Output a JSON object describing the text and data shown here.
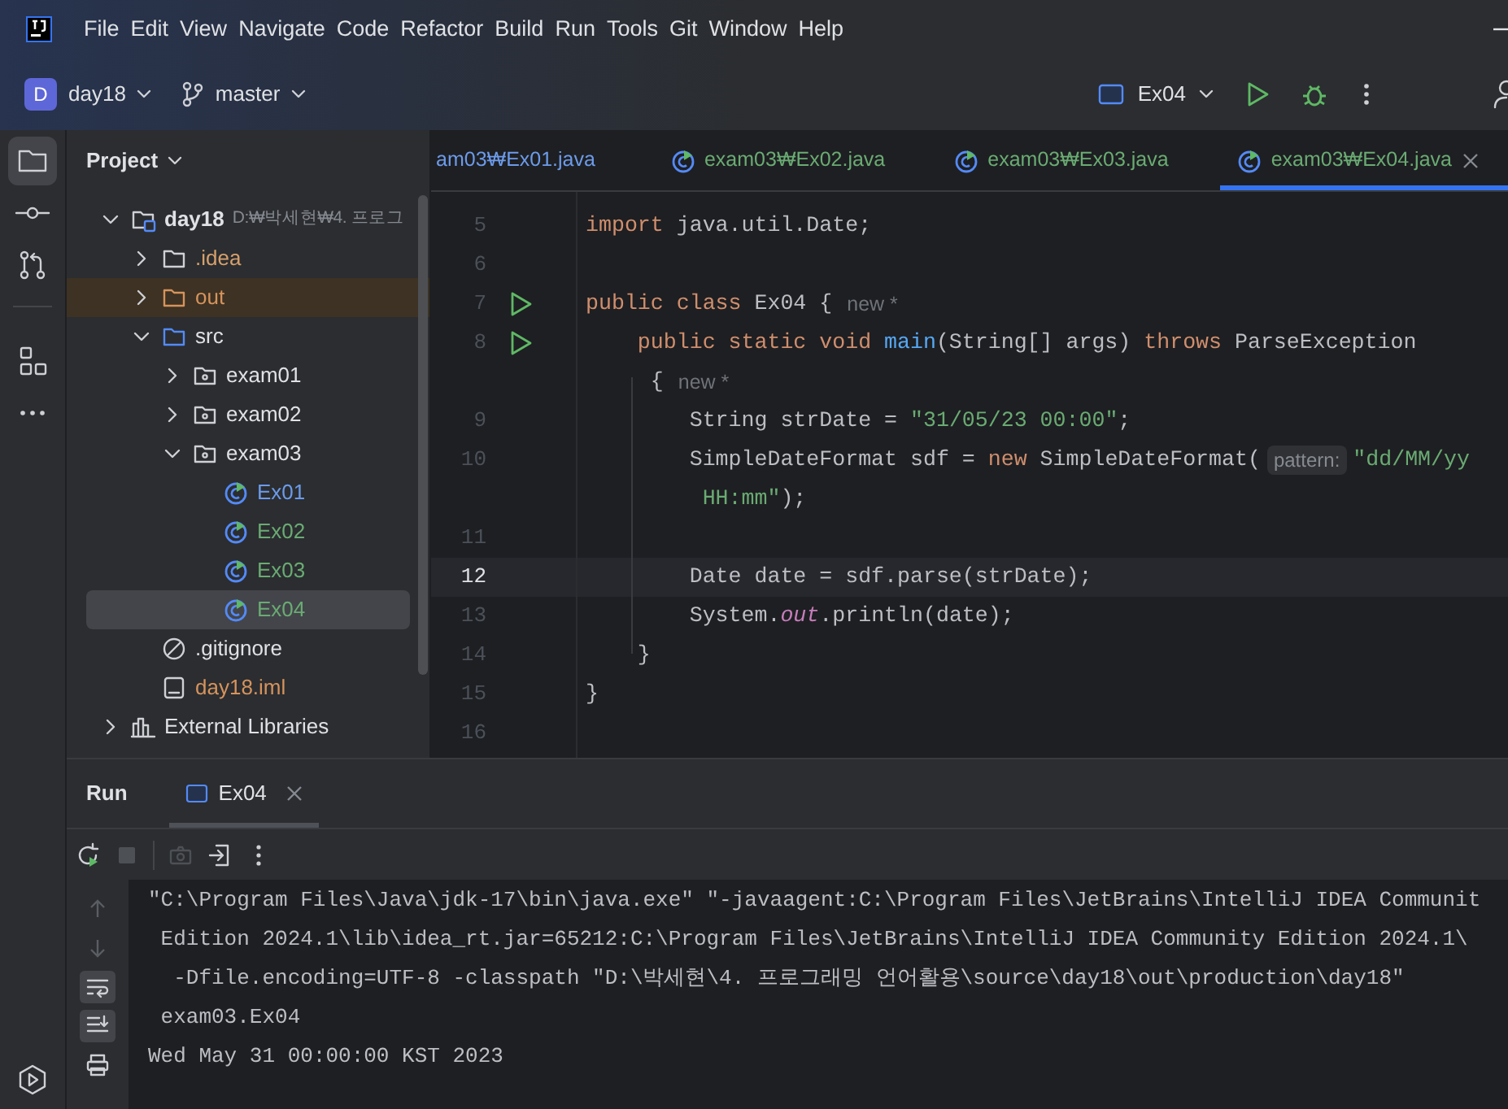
{
  "menu": [
    "File",
    "Edit",
    "View",
    "Navigate",
    "Code",
    "Refactor",
    "Build",
    "Run",
    "Tools",
    "Git",
    "Window",
    "Help"
  ],
  "toolbar": {
    "project_badge": "D",
    "project": "day18",
    "branch": "master",
    "run_config": "Ex04"
  },
  "tool_strip": [
    {
      "kind": "project",
      "selected": true
    },
    {
      "kind": "commit",
      "selected": false
    },
    {
      "kind": "pull-requests",
      "selected": false
    },
    {
      "kind": "structure",
      "selected": false
    },
    {
      "kind": "more",
      "selected": false
    }
  ],
  "project_panel": {
    "title": "Project",
    "tree": [
      {
        "label": "day18",
        "kind": "module",
        "path": "D:₩박세현₩4. 프로그",
        "color": "#dfe1e5",
        "selected": false,
        "expanded": true,
        "children": [
          {
            "label": ".idea",
            "kind": "folder",
            "color": "#d6a06c",
            "selected": false,
            "expanded": false
          },
          {
            "label": "out",
            "kind": "excluded-folder",
            "color": "#d6935c",
            "selected": false,
            "expanded": false
          },
          {
            "label": "src",
            "kind": "source-folder",
            "color": "#dfe1e5",
            "selected": false,
            "expanded": true,
            "children": [
              {
                "label": "exam01",
                "kind": "package",
                "color": "#dfe1e5",
                "selected": false,
                "expanded": false
              },
              {
                "label": "exam02",
                "kind": "package",
                "color": "#dfe1e5",
                "selected": false,
                "expanded": false
              },
              {
                "label": "exam03",
                "kind": "package",
                "color": "#dfe1e5",
                "selected": false,
                "expanded": true,
                "children": [
                  {
                    "label": "Ex01",
                    "kind": "class",
                    "color": "#6c9bea",
                    "selected": false
                  },
                  {
                    "label": "Ex02",
                    "kind": "class",
                    "color": "#6aab73",
                    "selected": false
                  },
                  {
                    "label": "Ex03",
                    "kind": "class",
                    "color": "#6aab73",
                    "selected": false
                  },
                  {
                    "label": "Ex04",
                    "kind": "class",
                    "color": "#6aab73",
                    "selected": true
                  }
                ]
              }
            ]
          },
          {
            "label": ".gitignore",
            "kind": "ignore-file",
            "color": "#dfe1e5",
            "selected": false
          },
          {
            "label": "day18.iml",
            "kind": "module-file",
            "color": "#d6935c",
            "selected": false
          }
        ]
      },
      {
        "label": "External Libraries",
        "kind": "libraries",
        "color": "#dfe1e5",
        "selected": false,
        "expanded": false
      }
    ]
  },
  "editor_tabs": [
    {
      "label": "am03₩Ex01.java",
      "color": "#6c9bea",
      "selected": false,
      "clipped": true
    },
    {
      "label": "exam03₩Ex02.java",
      "color": "#6aab73",
      "selected": false,
      "clipped": false
    },
    {
      "label": "exam03₩Ex03.java",
      "color": "#6aab73",
      "selected": false,
      "clipped": false
    },
    {
      "label": "exam03₩Ex04.java",
      "color": "#6aab73",
      "selected": true,
      "clipped": false
    }
  ],
  "code": [
    {
      "number": "5",
      "run": false,
      "current": false,
      "tokens": [
        {
          "text": "import ",
          "kind": "keyword"
        },
        {
          "text": "java.util.Date;",
          "kind": "plain"
        }
      ]
    },
    {
      "number": "6",
      "run": false,
      "current": false
    },
    {
      "number": "7",
      "run": true,
      "current": false,
      "tokens": [
        {
          "text": "public class ",
          "kind": "keyword"
        },
        {
          "text": "Ex04 {",
          "kind": "plain"
        },
        {
          "text": "new *",
          "kind": "hint"
        }
      ]
    },
    {
      "number": "8",
      "run": true,
      "current": false,
      "tokens": [
        {
          "text": "    public static void ",
          "kind": "keyword"
        },
        {
          "text": "main",
          "kind": "method"
        },
        {
          "text": "(String[] args) ",
          "kind": "plain"
        },
        {
          "text": "throws ",
          "kind": "keyword"
        },
        {
          "text": "ParseException",
          "kind": "plain"
        }
      ]
    },
    {
      "run": false,
      "current": false,
      "tokens": [
        {
          "text": "     {",
          "kind": "plain"
        },
        {
          "text": "new *",
          "kind": "hint"
        }
      ]
    },
    {
      "number": "9",
      "run": false,
      "current": false,
      "tokens": [
        {
          "text": "        String strDate = ",
          "kind": "plain"
        },
        {
          "text": "\"31/05/23 00:00\"",
          "kind": "string"
        },
        {
          "text": ";",
          "kind": "plain"
        }
      ]
    },
    {
      "number": "10",
      "run": false,
      "current": false,
      "tokens": [
        {
          "text": "        SimpleDateFormat sdf = ",
          "kind": "plain"
        },
        {
          "text": "new ",
          "kind": "keyword"
        },
        {
          "text": "SimpleDateFormat(",
          "kind": "plain"
        },
        {
          "text": "pattern:",
          "kind": "param"
        },
        {
          "text": "\"dd/MM/yy",
          "kind": "string"
        }
      ]
    },
    {
      "run": false,
      "current": false,
      "tokens": [
        {
          "text": "         HH:mm\"",
          "kind": "string"
        },
        {
          "text": ");",
          "kind": "plain"
        }
      ]
    },
    {
      "number": "11",
      "run": false,
      "current": false
    },
    {
      "number": "12",
      "run": false,
      "current": true,
      "tokens": [
        {
          "text": "        Date date = sdf.parse(strDate);",
          "kind": "plain"
        }
      ]
    },
    {
      "number": "13",
      "run": false,
      "current": false,
      "tokens": [
        {
          "text": "        System.",
          "kind": "plain"
        },
        {
          "text": "out",
          "kind": "static"
        },
        {
          "text": ".println(date);",
          "kind": "plain"
        }
      ]
    },
    {
      "number": "14",
      "run": false,
      "current": false,
      "tokens": [
        {
          "text": "    }",
          "kind": "plain"
        }
      ]
    },
    {
      "number": "15",
      "run": false,
      "current": false,
      "tokens": [
        {
          "text": "}",
          "kind": "plain"
        }
      ]
    },
    {
      "number": "16",
      "run": false,
      "current": false
    }
  ],
  "run_panel": {
    "title": "Run",
    "tabs": [
      {
        "label": "Ex04",
        "selected": true
      }
    ],
    "toolbar": [
      {
        "kind": "rerun",
        "disabled": false
      },
      {
        "kind": "stop",
        "disabled": true
      },
      {
        "kind": "camera",
        "disabled": true
      },
      {
        "kind": "exit",
        "disabled": false
      },
      {
        "kind": "more",
        "disabled": false
      }
    ],
    "side": [
      {
        "kind": "up",
        "on": false
      },
      {
        "kind": "down",
        "on": false
      },
      {
        "kind": "soft-wrap",
        "on": true
      },
      {
        "kind": "scroll-to-end",
        "on": true
      },
      {
        "kind": "print",
        "on": false
      }
    ],
    "output": [
      "\"C:\\Program Files\\Java\\jdk-17\\bin\\java.exe\" \"-javaagent:C:\\Program Files\\JetBrains\\IntelliJ IDEA Communit",
      " Edition 2024.1\\lib\\idea_rt.jar=65212:C:\\Program Files\\JetBrains\\IntelliJ IDEA Community Edition 2024.1\\",
      "  -Dfile.encoding=UTF-8 -classpath \"D:\\박세현\\4. 프로그래밍 언어활용\\source\\day18\\out\\production\\day18\"",
      " exam03.Ex04",
      "Wed May 31 00:00:00 KST 2023"
    ]
  }
}
